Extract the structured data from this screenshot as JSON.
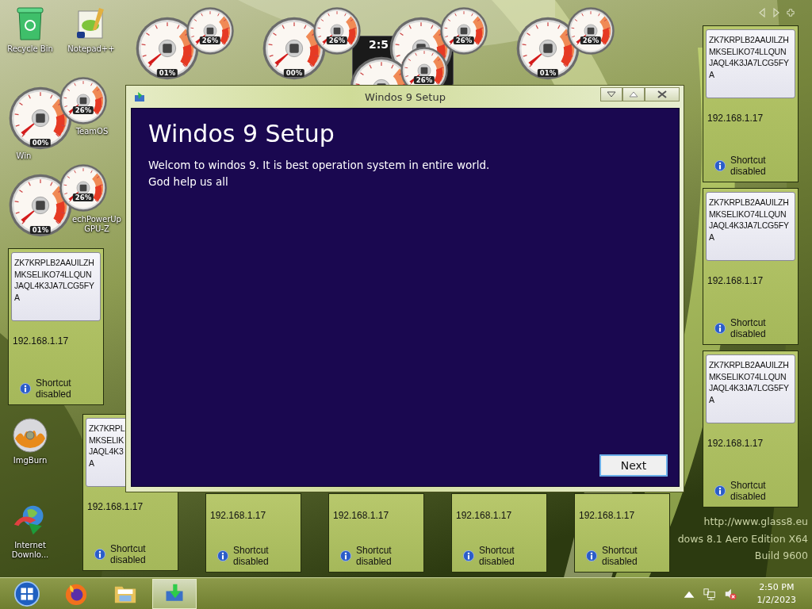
{
  "desktop_icons": [
    {
      "label": "Recycle Bin",
      "kind": "recycle"
    },
    {
      "label": "Notepad++",
      "kind": "notepad"
    },
    {
      "label": "TeamOS",
      "kind": "hidden"
    },
    {
      "label": "Win",
      "kind": "hidden"
    },
    {
      "label": "echPowerUp GPU-Z",
      "kind": "hidden"
    },
    {
      "label": "ImgBurn",
      "kind": "disc"
    },
    {
      "label": "Internet Downlo...",
      "kind": "download"
    }
  ],
  "clock_gadget": {
    "time": "2:5"
  },
  "gadgets": [
    {
      "cpu": "01%",
      "memory": "26%"
    },
    {
      "cpu": "00%",
      "memory": "26%"
    },
    {
      "cpu": "01%",
      "memory": "26%"
    },
    {
      "cpu": "00%",
      "memory": "26%"
    },
    {
      "cpu": "01%",
      "memory": "26%"
    },
    {
      "memory": "26%"
    },
    {
      "memory": "26%"
    }
  ],
  "notes": [
    {
      "key_lines": [
        "ZK7KRPLB2AAUILZH",
        "MKSELIKO74LLQUN",
        "JAQL4K3JA7LCG5FY",
        "A"
      ],
      "ip": "192.168.1.17",
      "status": "Shortcut disabled"
    },
    {
      "key_lines": [
        "ZK7KRPLB2AAUILZH",
        "MKSELIKO74LLQUN",
        "JAQL4K3JA7LCG5FY",
        "A"
      ],
      "ip": "192.168.1.17",
      "status": "Shortcut disabled"
    },
    {
      "key_lines": [
        "ZK7KRPLB2AAUILZH",
        "MKSELIKO74LLQUN",
        "JAQL4K3JA7LCG5FY",
        "A"
      ],
      "ip": "192.168.1.17",
      "status": "Shortcut disabled"
    },
    {
      "key_lines": [
        "ZK7KRPLB2AAUILZH",
        "MKSELIKO74LLQUN",
        "JAQL4K3JA7LCG5FY",
        "A"
      ],
      "ip": "192.168.1.17",
      "status": "Shortcut disabled"
    },
    {
      "key_lines": [
        "ZK7KRPL",
        "MKSELIK",
        "JAQL4K3",
        "A"
      ],
      "ip": "192.168.1.17",
      "status": "Shortcut disabled"
    },
    {
      "ip": "192.168.1.17",
      "status": "Shortcut disabled"
    },
    {
      "ip": "192.168.1.17",
      "status": "Shortcut disabled"
    },
    {
      "ip": "192.168.1.17",
      "status": "Shortcut disabled"
    },
    {
      "ip": "192.168.1.17",
      "status": "Shortcut disabled"
    }
  ],
  "setup_window": {
    "title": "Windos 9 Setup",
    "heading": "Windos 9 Setup",
    "body": [
      "Welcom to windos 9. It is best operation system in entire world.",
      "God help us all"
    ],
    "button": "Next"
  },
  "os_info": [
    "http://www.glass8.eu",
    "dows 8.1 Aero Edition X64",
    "Build 9600"
  ],
  "taskbar": {
    "apps": [
      {
        "kind": "start",
        "selected": false
      },
      {
        "kind": "browser",
        "selected": false
      },
      {
        "kind": "folder",
        "selected": false
      },
      {
        "kind": "setup",
        "selected": true
      }
    ],
    "time": "2:50 PM",
    "date": "1/2/2023"
  }
}
